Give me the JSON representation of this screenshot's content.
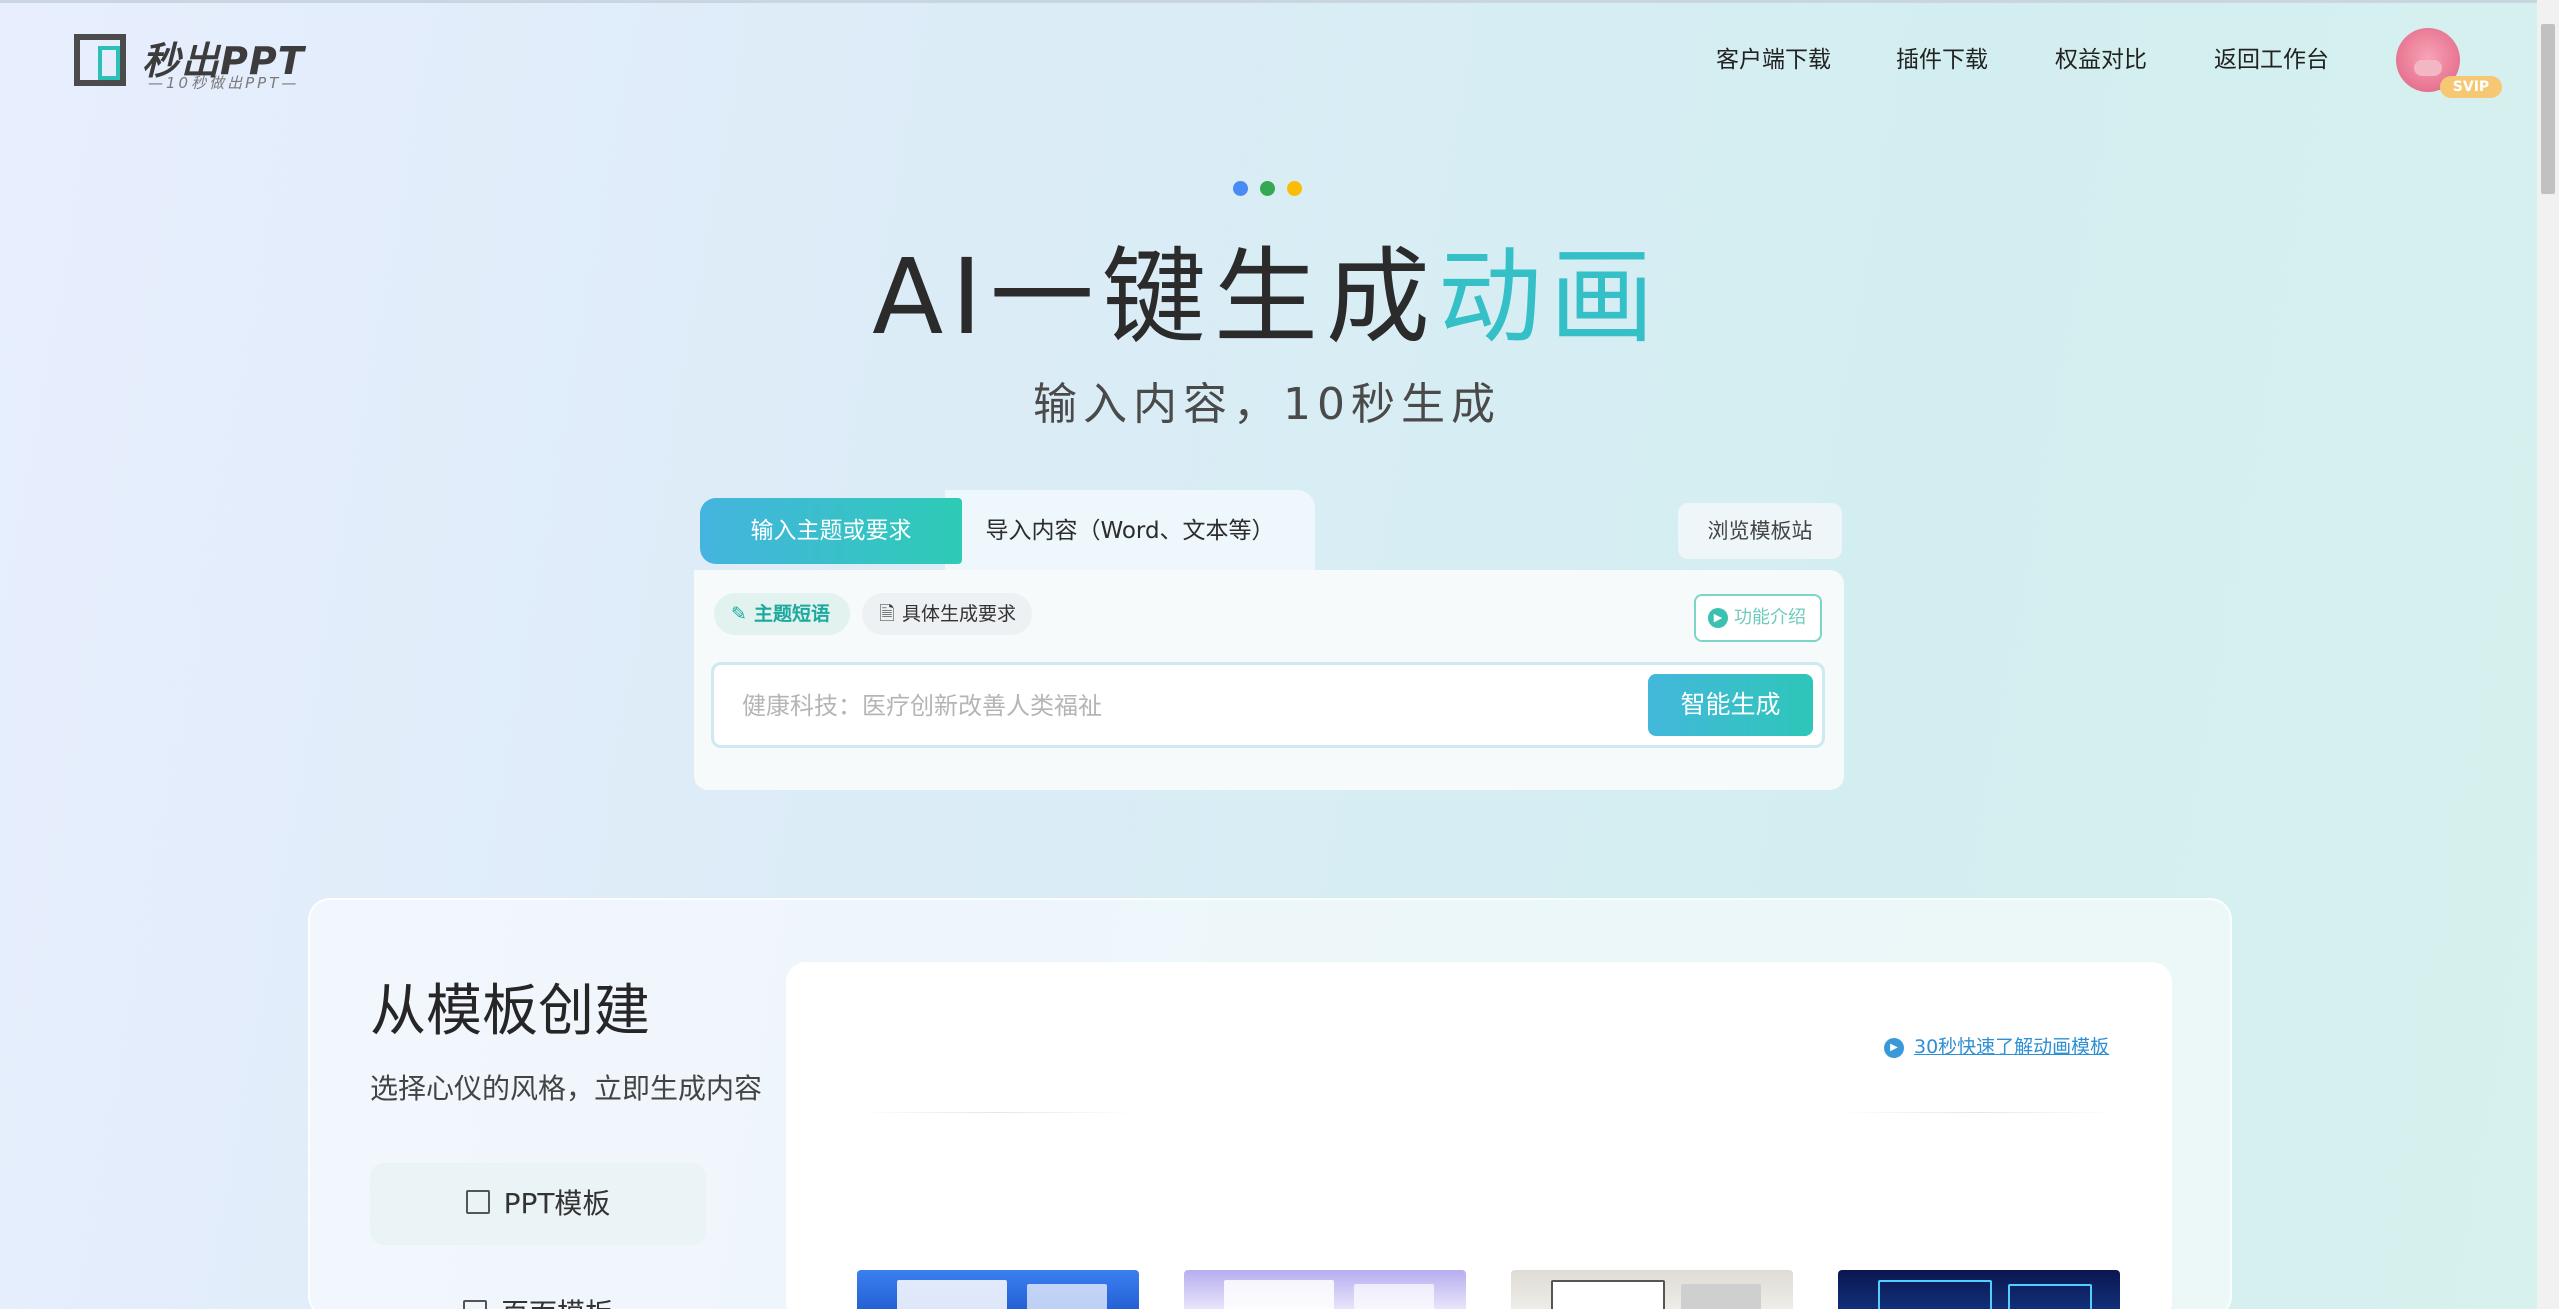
{
  "header": {
    "logo_name": "秒出PPT",
    "logo_tagline": "—10秒做出PPT—",
    "nav": [
      "客户端下载",
      "插件下载",
      "权益对比",
      "返回工作台"
    ],
    "badge": "SVIP"
  },
  "hero": {
    "title_main": "AI一键生成",
    "title_accent": "动画",
    "subtitle": "输入内容，10秒生成",
    "dot_colors": [
      "#4a8af4",
      "#34a853",
      "#fbbc05"
    ],
    "accent_color": "#35c0c8"
  },
  "generator": {
    "tab_active": "输入主题或要求",
    "tab_inactive": "导入内容（Word、文本等）",
    "browse_label": "浏览模板站",
    "chip_theme": "主题短语",
    "chip_requirements": "具体生成要求",
    "function_intro": "功能介绍",
    "input_placeholder": "健康科技：医疗创新改善人类福祉",
    "input_value": "",
    "generate_label": "智能生成"
  },
  "templates": {
    "title": "从模板创建",
    "subtitle": "选择心仪的风格，立即生成内容",
    "sidebar_items": [
      "PPT模板",
      "页面模板"
    ],
    "video_link": "30秒快速了解动画模板",
    "thumbnail_colors": [
      "#2f6fe0",
      "#9b8fe6",
      "#e8e6df",
      "#0e1d5c"
    ]
  }
}
